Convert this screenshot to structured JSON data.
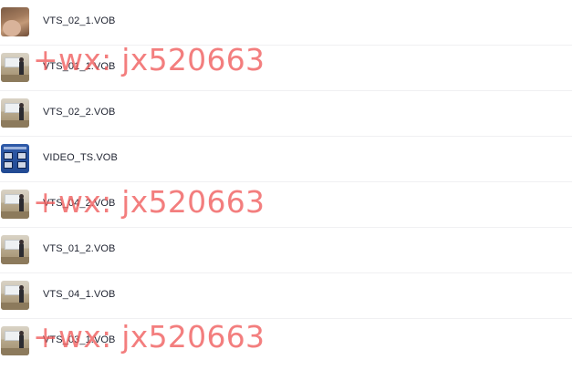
{
  "files": [
    {
      "name": "VTS_02_1.VOB",
      "thumb_icon": "video-thumbnail-face-icon"
    },
    {
      "name": "VTS_01_1.VOB",
      "thumb_icon": "video-thumbnail-presenter-icon"
    },
    {
      "name": "VTS_02_2.VOB",
      "thumb_icon": "video-thumbnail-presenter-icon"
    },
    {
      "name": "VIDEO_TS.VOB",
      "thumb_icon": "video-thumbnail-menu-icon"
    },
    {
      "name": "VTS_04_2.VOB",
      "thumb_icon": "video-thumbnail-presenter-icon"
    },
    {
      "name": "VTS_01_2.VOB",
      "thumb_icon": "video-thumbnail-presenter-icon"
    },
    {
      "name": "VTS_04_1.VOB",
      "thumb_icon": "video-thumbnail-presenter-icon"
    },
    {
      "name": "VTS_03_1.VOB",
      "thumb_icon": "video-thumbnail-presenter-icon"
    }
  ],
  "watermark": {
    "text": "+wx: jx520663",
    "color": "#f05a5a"
  },
  "colors": {
    "text": "#1f2330",
    "divider": "#f0f0f2",
    "background": "#ffffff"
  }
}
